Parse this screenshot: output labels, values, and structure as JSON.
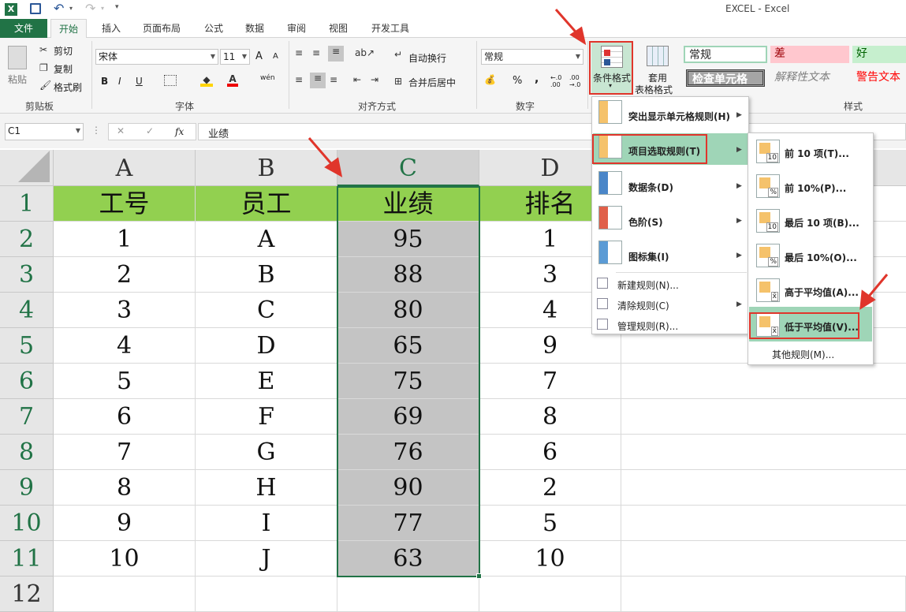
{
  "window": {
    "title": "EXCEL - Excel"
  },
  "tabs": [
    "文件",
    "开始",
    "插入",
    "页面布局",
    "公式",
    "数据",
    "审阅",
    "视图",
    "开发工具"
  ],
  "active_tab": "开始",
  "ribbon": {
    "clipboard": {
      "label": "剪贴板",
      "paste": "粘贴",
      "cut": "剪切",
      "copy": "复制",
      "format_painter": "格式刷"
    },
    "font": {
      "label": "字体",
      "font_name": "宋体",
      "font_size": "11",
      "bold": "B",
      "italic": "I",
      "underline": "U",
      "grow": "A",
      "shrink": "A",
      "phonetic": "wén"
    },
    "alignment": {
      "label": "对齐方式",
      "wrap_text": "自动换行",
      "merge_center": "合并后居中"
    },
    "number": {
      "label": "数字",
      "format": "常规",
      "percent": "%",
      "comma": ",",
      "inc_decimal": "←.0 .00",
      "dec_decimal": ".00 →.0"
    },
    "styles": {
      "label": "样式",
      "conditional_formatting": "条件格式",
      "format_as_table": "套用",
      "format_as_table2": "表格格式",
      "normal": "常规",
      "bad": "差",
      "good": "好",
      "check_cell": "检查单元格",
      "explanatory": "解释性文本",
      "warning": "警告文本"
    }
  },
  "formula_bar": {
    "name_box": "C1",
    "fx": "fx",
    "content": "业绩"
  },
  "columns": [
    "A",
    "B",
    "C",
    "D"
  ],
  "rows": [
    "1",
    "2",
    "3",
    "4",
    "5",
    "6",
    "7",
    "8",
    "9",
    "10",
    "11",
    "12"
  ],
  "table": {
    "headers": [
      "工号",
      "员工",
      "业绩",
      "排名"
    ],
    "data": [
      [
        "1",
        "A",
        "95",
        "1"
      ],
      [
        "2",
        "B",
        "88",
        "3"
      ],
      [
        "3",
        "C",
        "80",
        "4"
      ],
      [
        "4",
        "D",
        "65",
        "9"
      ],
      [
        "5",
        "E",
        "75",
        "7"
      ],
      [
        "6",
        "F",
        "69",
        "8"
      ],
      [
        "7",
        "G",
        "76",
        "6"
      ],
      [
        "8",
        "H",
        "90",
        "2"
      ],
      [
        "9",
        "I",
        "77",
        "5"
      ],
      [
        "10",
        "J",
        "63",
        "10"
      ]
    ]
  },
  "cf_menu": [
    {
      "label": "突出显示单元格规则(H)",
      "submenu": true
    },
    {
      "label": "项目选取规则(T)",
      "submenu": true,
      "highlighted": true
    },
    {
      "label": "数据条(D)",
      "submenu": true
    },
    {
      "label": "色阶(S)",
      "submenu": true
    },
    {
      "label": "图标集(I)",
      "submenu": true
    },
    {
      "label": "新建规则(N)...",
      "submenu": false
    },
    {
      "label": "清除规则(C)",
      "submenu": true
    },
    {
      "label": "管理规则(R)...",
      "submenu": false
    }
  ],
  "top_bottom_menu": [
    {
      "label": "前 10 项(T)...",
      "icon_label": "10"
    },
    {
      "label": "前 10%(P)...",
      "icon_label": "%"
    },
    {
      "label": "最后 10 项(B)...",
      "icon_label": "10"
    },
    {
      "label": "最后 10%(O)...",
      "icon_label": "%"
    },
    {
      "label": "高于平均值(A)...",
      "icon_label": "x̄"
    },
    {
      "label": "低于平均值(V)...",
      "icon_label": "x̄",
      "highlighted": true
    },
    {
      "label": "其他规则(M)..."
    }
  ],
  "colors": {
    "excel_green": "#217346",
    "header_fill": "#92d050",
    "selection": "#c4c4c4",
    "menu_highlight": "#9fd5b7",
    "annotation": "#e0352b",
    "bad_bg": "#ffc7ce",
    "good_bg": "#c6efce"
  }
}
